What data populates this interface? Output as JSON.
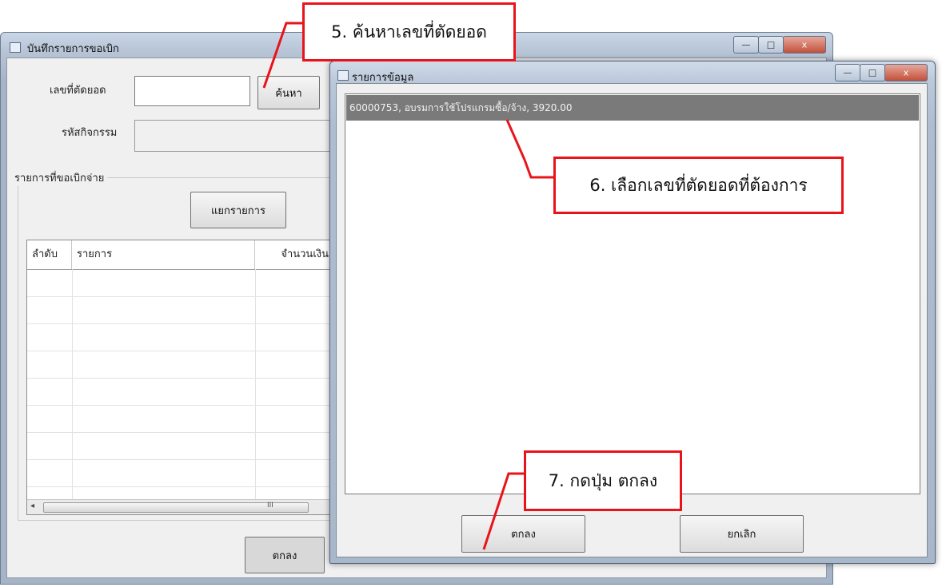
{
  "back_window": {
    "title": "บันทึกรายการขอเบิก",
    "caption_buttons": {
      "minimize": "—",
      "maximize": "□",
      "close": "x"
    },
    "label_cut_number": "เลขที่ตัดยอด",
    "input_cut_number": "",
    "search_button": "ค้นหา",
    "label_activity_code": "รหัสกิจกรรม",
    "input_activity_code": "",
    "group_label": "รายการที่ขอเบิกจ่าย",
    "split_button": "แยกรายการ",
    "grid_columns": [
      "ลำดับ",
      "รายการ",
      "จำนวนเงิน"
    ],
    "scroll_left": "◂",
    "scroll_grip": "III",
    "ok_button": "ตกลง"
  },
  "dialog": {
    "title": "รายการข้อมูล",
    "caption_buttons": {
      "minimize": "—",
      "maximize": "□",
      "close": "x"
    },
    "list_items": [
      "60000753, อบรมการใช้โปรแกรมซื้อ/จ้าง, 3920.00"
    ],
    "ok_button": "ตกลง",
    "cancel_button": "ยกเลิก"
  },
  "annotations": {
    "step5": "5. ค้นหาเลขที่ตัดยอด",
    "step6": "6. เลือกเลขที่ตัดยอดที่ต้องการ",
    "step7": "7. กดปุ่ม ตกลง",
    "accent_color": "#e8141a"
  }
}
